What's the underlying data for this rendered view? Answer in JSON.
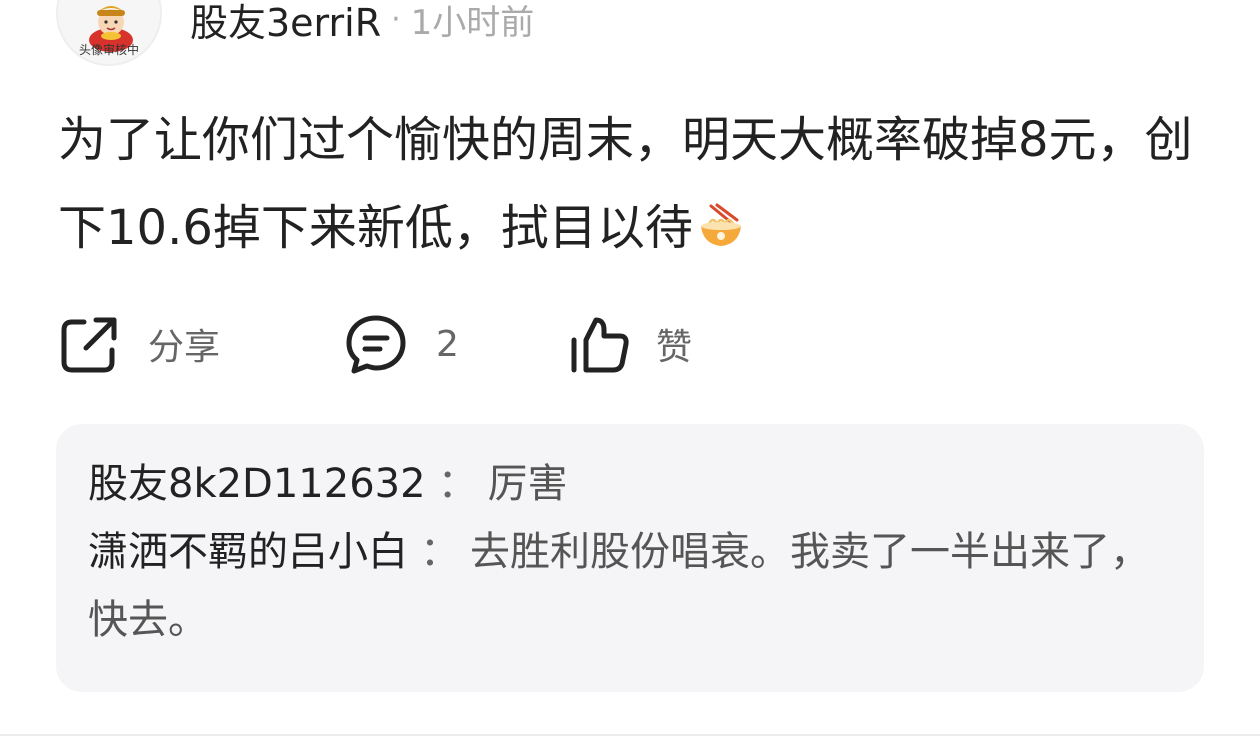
{
  "post": {
    "avatar_badge": "头像审核中",
    "username": "股友3erriR",
    "separator": "·",
    "time": "1小时前",
    "content": "为了让你们过个愉快的周末，明天大概率破掉8元，创下10.6掉下来新低，拭目以待",
    "content_emoji_icon": "noodle-bowl-icon"
  },
  "actions": {
    "share_label": "分享",
    "comment_count": "2",
    "like_label": "赞"
  },
  "comments": [
    {
      "author": "股友8k2D112632",
      "separator": "：",
      "text": "厉害"
    },
    {
      "author": "潇洒不羁的吕小白",
      "separator": "：",
      "text": "去胜利股份唱衰。我卖了一半出来了，快去。"
    }
  ],
  "colors": {
    "text_primary": "#222222",
    "text_secondary": "#666666",
    "text_muted": "#aaaaaa",
    "comment_bg": "#f5f5f7"
  }
}
